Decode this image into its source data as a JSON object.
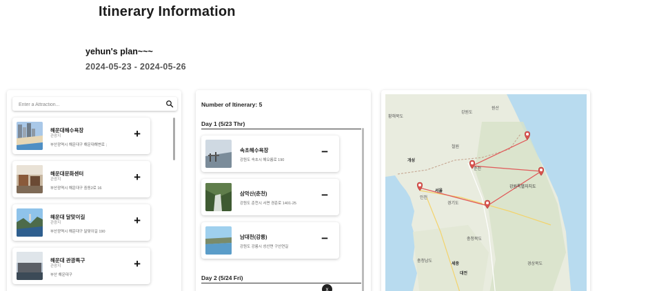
{
  "header": {
    "title": "Itinerary Information",
    "plan_name": "yehun's plan~~~",
    "dates": "2024-05-23 - 2024-05-26"
  },
  "search": {
    "placeholder": "Enter a Attraction...",
    "icon": "search-icon"
  },
  "attractions": [
    {
      "name": "해운대해수욕장",
      "category": "관광지",
      "address": "부산광역시 해운대구 해운대해변로 ;",
      "add_label": "+"
    },
    {
      "name": "해운대문화센터",
      "category": "관광지",
      "address": "부산광역시 해운대구 중동2로 16",
      "add_label": "+"
    },
    {
      "name": "해운대 달맞이길",
      "category": "관광지",
      "address": "부산광역시 해운대구 달맞이길 190",
      "add_label": "+"
    },
    {
      "name": "해운대 관광특구",
      "category": "관광지",
      "address": "부산 해운대구",
      "add_label": "+"
    }
  ],
  "itinerary": {
    "count_label": "Number of Itinerary: 5",
    "days": [
      {
        "label": "Day 1 (5/23 Thr)",
        "items": [
          {
            "name": "속초해수욕장",
            "address": "강원도 속초시 해오름로 190",
            "remove_label": "−"
          },
          {
            "name": "삼악산(춘천)",
            "address": "강원도 춘천시 서면 경춘로 1401-25",
            "remove_label": "−"
          },
          {
            "name": "남대천(강릉)",
            "address": "강원도 강릉시 성산면 구산연길",
            "remove_label": "−"
          }
        ]
      },
      {
        "label": "Day 2 (5/24 Fri)",
        "items": []
      }
    ],
    "close_label": "x"
  },
  "map": {
    "labels": [
      {
        "text": "황해북도",
        "region": "northwest"
      },
      {
        "text": "강원도",
        "region": "north"
      },
      {
        "text": "원산",
        "region": "north"
      },
      {
        "text": "개성",
        "region": "west"
      },
      {
        "text": "철원",
        "region": "north"
      },
      {
        "text": "인천",
        "region": "west"
      },
      {
        "text": "서울",
        "region": "center"
      },
      {
        "text": "춘천",
        "region": "center"
      },
      {
        "text": "강원특별자치도",
        "region": "east"
      },
      {
        "text": "경기도",
        "region": "center"
      },
      {
        "text": "충청북도",
        "region": "south"
      },
      {
        "text": "충청남도",
        "region": "southwest"
      },
      {
        "text": "세종",
        "region": "south"
      },
      {
        "text": "대전",
        "region": "south"
      },
      {
        "text": "경상북도",
        "region": "southeast"
      }
    ],
    "markers": [
      "속초",
      "춘천",
      "강릉",
      "인천",
      "원주"
    ],
    "route_color": "#e05a5a",
    "marker_color": "#d9534f"
  }
}
